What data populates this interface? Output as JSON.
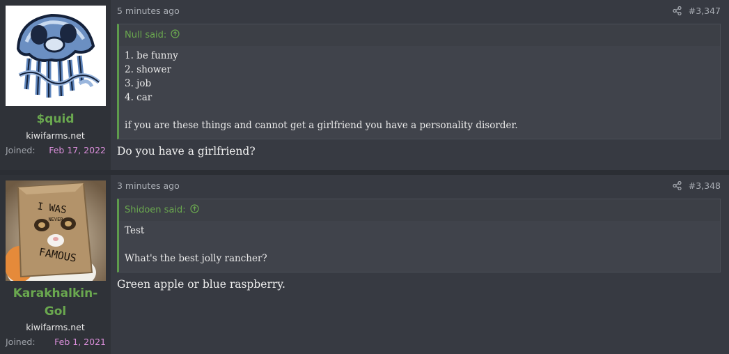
{
  "posts": [
    {
      "username": "$quid",
      "user_title": "kiwifarms.net",
      "joined_label": "Joined:",
      "joined_date": "Feb 17, 2022",
      "time": "5 minutes ago",
      "post_number": "#3,347",
      "quote_author": "Null said:",
      "quote_lines": [
        "1. be funny",
        "2. shower",
        "3. job",
        "4. car",
        "",
        "if you are these things and cannot get a girlfriend you have a personality disorder."
      ],
      "message": "Do you have a girlfriend?"
    },
    {
      "username_line1": "Karakhalkin-",
      "username_line2": "Gol",
      "user_title": "kiwifarms.net",
      "joined_label": "Joined:",
      "joined_date": "Feb 1, 2021",
      "time": "3 minutes ago",
      "post_number": "#3,348",
      "quote_author": "Shidoen said:",
      "quote_lines": [
        "Test",
        "",
        "What's the best jolly rancher?"
      ],
      "message": "Green apple or blue raspberry.",
      "avatar_text": [
        "I WAS",
        "NEVER",
        "FAMOUS"
      ]
    }
  ],
  "colors": {
    "username": "#6aa84f",
    "joined_date": "#d98ed9",
    "quote_border": "#5e9b4c"
  },
  "icons": [
    "share-icon",
    "up-arrow-circle-icon"
  ]
}
